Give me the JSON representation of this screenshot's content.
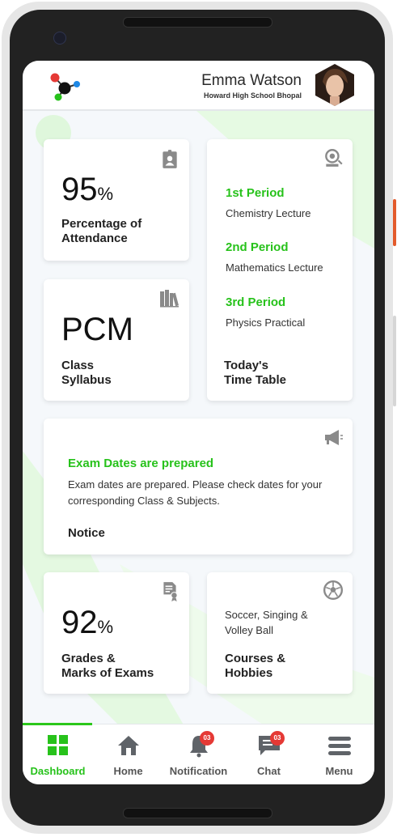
{
  "user": {
    "name": "Emma Watson",
    "school": "Howard High School Bhopal"
  },
  "colors": {
    "accent": "#27c21b",
    "badge": "#e53935",
    "icon": "#8a8a8a",
    "nav_icon": "#5f6368"
  },
  "attendance": {
    "value": "95",
    "unit": "%",
    "label": "Percentage of\nAttendance",
    "icon": "id-badge-icon"
  },
  "syllabus": {
    "value": "PCM",
    "label": "Class\nSyllabus",
    "icon": "books-icon"
  },
  "timetable": {
    "icon": "projector-icon",
    "periods": [
      {
        "title": "1st Period",
        "text": "Chemistry Lecture"
      },
      {
        "title": "2nd Period",
        "text": "Mathematics Lecture"
      },
      {
        "title": "3rd Period",
        "text": "Physics Practical"
      }
    ],
    "label": "Today's\nTime Table"
  },
  "notice": {
    "icon": "megaphone-icon",
    "title": "Exam Dates are prepared",
    "text": "Exam dates are prepared. Please check dates  for your corresponding Class & Subjects.",
    "label": "Notice"
  },
  "grades": {
    "value": "92",
    "unit": "%",
    "label": "Grades &\nMarks of Exams",
    "icon": "certificate-icon"
  },
  "courses": {
    "text": "Soccer, Singing & Volley Ball",
    "label": "Courses &\nHobbies",
    "icon": "soccer-ball-icon"
  },
  "nav": {
    "items": [
      {
        "label": "Dashboard",
        "icon": "dashboard-icon",
        "active": true
      },
      {
        "label": "Home",
        "icon": "home-icon"
      },
      {
        "label": "Notification",
        "icon": "bell-icon",
        "badge": "03"
      },
      {
        "label": "Chat",
        "icon": "chat-icon",
        "badge": "03"
      },
      {
        "label": "Menu",
        "icon": "menu-icon"
      }
    ]
  }
}
